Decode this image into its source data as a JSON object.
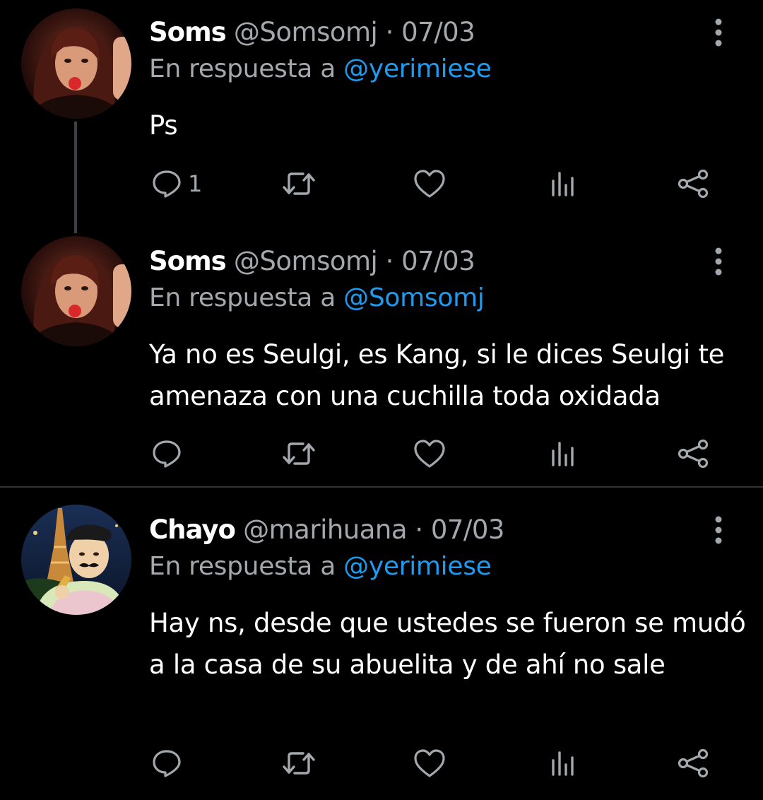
{
  "colors": {
    "background": "#000000",
    "text": "#ffffff",
    "secondary": "#a2a8ad",
    "link": "#1d9bf0",
    "divider": "#2f3336"
  },
  "tweets": [
    {
      "name": "Soms",
      "handle": "@Somsomj",
      "separator": "·",
      "date": "07/03",
      "reply_prefix": "En respuesta a",
      "reply_to": "@yerimiese",
      "text": "Ps",
      "reply_count": "1",
      "avatar": "avatar-photo",
      "more": "more-vertical-icon"
    },
    {
      "name": "Soms",
      "handle": "@Somsomj",
      "separator": "·",
      "date": "07/03",
      "reply_prefix": "En respuesta a",
      "reply_to": "@Somsomj",
      "text": "Ya no es Seulgi, es Kang, si le dices Seulgi te amenaza con una cuchilla toda oxidada",
      "reply_count": "",
      "avatar": "avatar-photo",
      "more": "more-vertical-icon"
    },
    {
      "name": "Chayo",
      "handle": "@marihuana",
      "separator": "·",
      "date": "07/03",
      "reply_prefix": "En respuesta a",
      "reply_to": "@yerimiese",
      "text": "Hay ns, desde que ustedes se fueron se mudó a la casa de su abuelita y de ahí no sale",
      "reply_count": "",
      "avatar": "avatar-photo",
      "more": "more-vertical-icon"
    }
  ],
  "action_icons": [
    "reply-icon",
    "retweet-icon",
    "like-icon",
    "analytics-icon",
    "share-icon"
  ]
}
